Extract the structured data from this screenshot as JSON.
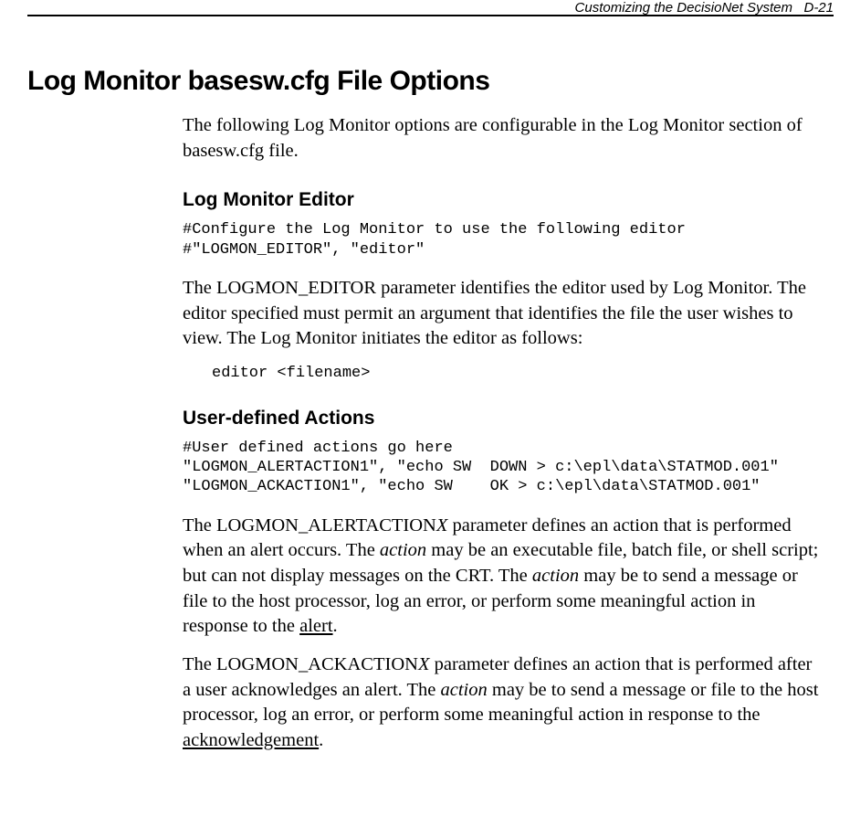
{
  "header": {
    "title": "Customizing the DecisioNet System",
    "page": "D-21"
  },
  "h1": "Log Monitor basesw.cfg File Options",
  "intro": "The following Log Monitor options are configurable in the Log Monitor section of basesw.cfg file.",
  "section1": {
    "heading": "Log Monitor Editor",
    "code": "#Configure the Log Monitor to use the following editor\n#\"LOGMON_EDITOR\", \"editor\"",
    "para": "The LOGMON_EDITOR parameter identifies the editor used by Log Monitor. The editor specified must permit an argument that identifies the file the user wishes to view. The Log Monitor initiates the editor as follows:",
    "code2": "editor <filename>"
  },
  "section2": {
    "heading": "User-defined Actions",
    "code": "#User defined actions go here\n\"LOGMON_ALERTACTION1\", \"echo SW  DOWN > c:\\epl\\data\\STATMOD.001\"\n\"LOGMON_ACKACTION1\", \"echo SW    OK > c:\\epl\\data\\STATMOD.001\"",
    "p1a": "The LOGMON_ALERTACTION",
    "p1x": "X",
    "p1b": " parameter defines an action that is performed when an alert occurs. The ",
    "p1action1": "action",
    "p1c": " may be an executable file, batch file, or shell script; but can not display messages on the CRT. The ",
    "p1action2": "action",
    "p1d": " may be to send a message or file to the host processor, log an error, or perform some meaningful action in response to the ",
    "p1alert": "alert",
    "p1e": ".",
    "p2a": "The LOGMON_ACKACTION",
    "p2x": "X",
    "p2b": " parameter defines an action that is performed after a user acknowledges an alert. The ",
    "p2action": "action",
    "p2c": " may be to send a message or file to the host processor, log an error, or perform some meaningful action in response to the ",
    "p2ack": "acknowledgement",
    "p2d": "."
  }
}
